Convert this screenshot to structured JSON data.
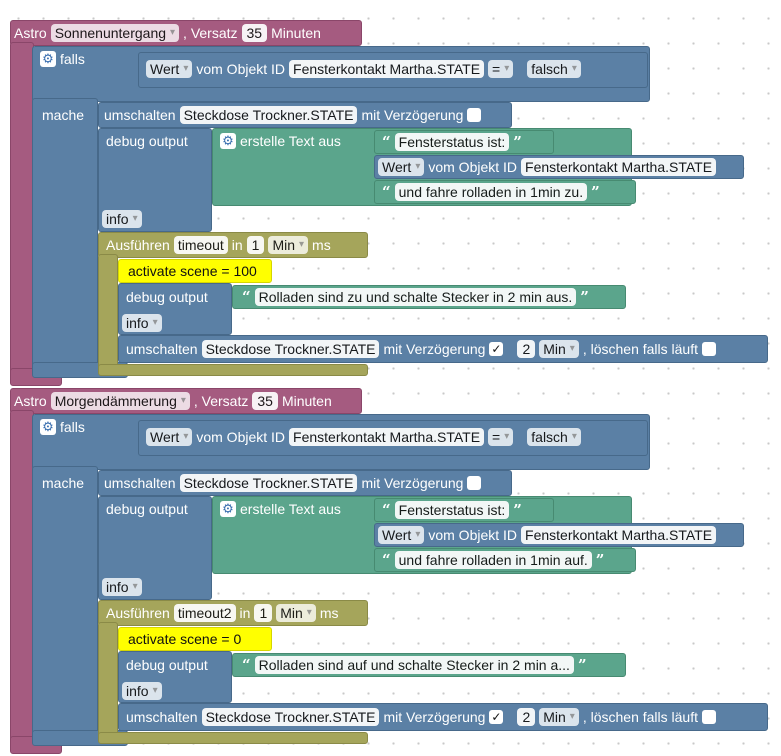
{
  "blocks": [
    {
      "header": {
        "astro": "Astro",
        "event": "Sonnenuntergang",
        "versatz": ", Versatz",
        "offset": "35",
        "minuten": "Minuten"
      },
      "if": {
        "falls": "falls",
        "mache": "mache",
        "wert": "Wert",
        "vom_objekt": "vom Objekt ID",
        "object": "Fensterkontakt Martha.STATE",
        "op": "=",
        "value": "falsch"
      },
      "toggle1": {
        "umschalten": "umschalten",
        "device": "Steckdose Trockner.STATE",
        "mit": "mit Verzögerung"
      },
      "debug1": {
        "label": "debug output",
        "erstelle": "erstelle Text aus",
        "text1": "Fensterstatus ist:",
        "wert": "Wert",
        "vom_objekt": "vom Objekt ID",
        "object": "Fensterkontakt Martha.STATE",
        "text2": "und fahre rolladen in 1min zu.",
        "info": "info"
      },
      "timeout": {
        "ausfuehren": "Ausführen",
        "name": "timeout",
        "in": "in",
        "n": "1",
        "unit": "Min",
        "ms": "ms"
      },
      "scene": "activate scene = 100",
      "debug2": {
        "label": "debug output",
        "text": "Rolladen sind zu und schalte Stecker in 2 min aus.",
        "info": "info"
      },
      "toggle2": {
        "umschalten": "umschalten",
        "device": "Steckdose Trockner.STATE",
        "mit": "mit Verzögerung",
        "check": "✓",
        "n": "2",
        "unit": "Min",
        "clear": ", löschen falls läuft"
      }
    },
    {
      "header": {
        "astro": "Astro",
        "event": "Morgendämmerung",
        "versatz": ", Versatz",
        "offset": "35",
        "minuten": "Minuten"
      },
      "if": {
        "falls": "falls",
        "mache": "mache",
        "wert": "Wert",
        "vom_objekt": "vom Objekt ID",
        "object": "Fensterkontakt Martha.STATE",
        "op": "=",
        "value": "falsch"
      },
      "toggle1": {
        "umschalten": "umschalten",
        "device": "Steckdose Trockner.STATE",
        "mit": "mit Verzögerung"
      },
      "debug1": {
        "label": "debug output",
        "erstelle": "erstelle Text aus",
        "text1": "Fensterstatus ist:",
        "wert": "Wert",
        "vom_objekt": "vom Objekt ID",
        "object": "Fensterkontakt Martha.STATE",
        "text2": "und fahre rolladen in 1min auf.",
        "info": "info"
      },
      "timeout": {
        "ausfuehren": "Ausführen",
        "name": "timeout2",
        "in": "in",
        "n": "1",
        "unit": "Min",
        "ms": "ms"
      },
      "scene": "activate scene = 0",
      "debug2": {
        "label": "debug output",
        "text": "Rolladen sind auf und schalte Stecker in 2 min a...",
        "info": "info"
      },
      "toggle2": {
        "umschalten": "umschalten",
        "device": "Steckdose Trockner.STATE",
        "mit": "mit Verzögerung",
        "check": "✓",
        "n": "2",
        "unit": "Min",
        "clear": ", löschen falls läuft"
      }
    }
  ],
  "colors": {
    "astro": "#a55b80",
    "logic": "#5b80a5",
    "text": "#5ba58c",
    "timeout": "#a5a55b",
    "scene": "#ffff00"
  }
}
